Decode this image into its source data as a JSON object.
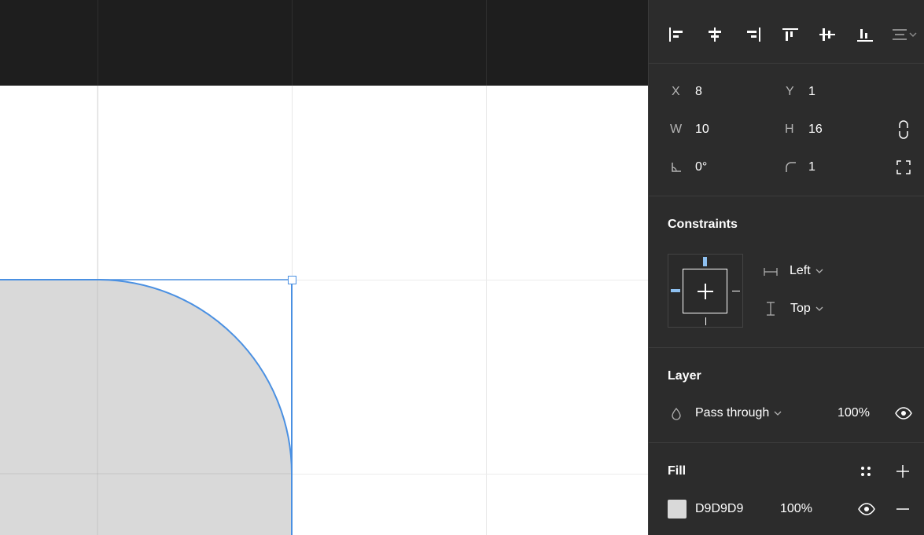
{
  "canvas": {
    "background": "#ffffff",
    "toolbar_color": "#1e1e1e",
    "shape_fill": "#D9D9D9",
    "selection_color": "#4a90e2"
  },
  "align": {
    "icons": [
      "align-left-icon",
      "align-horizontal-center-icon",
      "align-right-icon",
      "align-top-icon",
      "align-vertical-center-icon",
      "align-bottom-icon",
      "distribute-menu-icon"
    ]
  },
  "properties": {
    "x_label": "X",
    "x_value": "8",
    "y_label": "Y",
    "y_value": "1",
    "w_label": "W",
    "w_value": "10",
    "h_label": "H",
    "h_value": "16",
    "rotation_value": "0°",
    "radius_value": "1"
  },
  "constraints": {
    "title": "Constraints",
    "horizontal": "Left",
    "vertical": "Top"
  },
  "layer": {
    "title": "Layer",
    "blend_mode": "Pass through",
    "opacity": "100%"
  },
  "fill": {
    "title": "Fill",
    "color_hex": "D9D9D9",
    "swatch": "#D9D9D9",
    "opacity": "100%"
  }
}
